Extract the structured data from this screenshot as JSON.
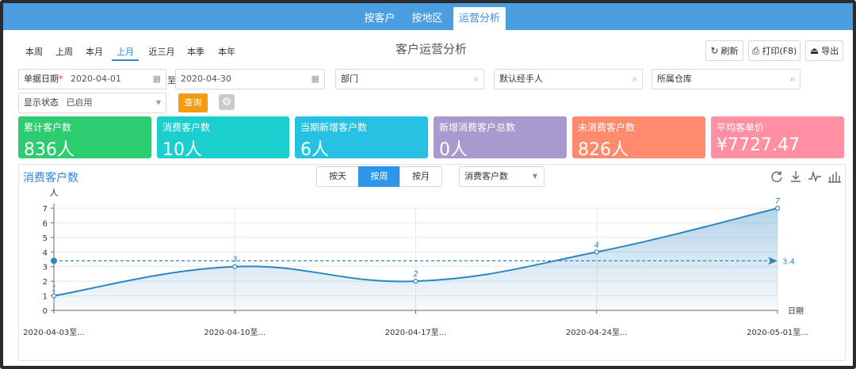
{
  "nav": {
    "tabs": [
      {
        "label": "按客户"
      },
      {
        "label": "按地区"
      },
      {
        "label": "运营分析"
      }
    ]
  },
  "periods": [
    "本周",
    "上周",
    "本月",
    "上月",
    "近三月",
    "本季",
    "本年"
  ],
  "page_title": "客户运营分析",
  "actions": {
    "refresh": "刷新",
    "print": "打印(F8)",
    "export": "导出"
  },
  "filters": {
    "date_label": "单据日期",
    "date_required_mark": "*",
    "date_from": "2020-04-01",
    "date_sep": "至",
    "date_to": "2020-04-30",
    "department_placeholder": "部门",
    "handler_value": "默认经手人",
    "warehouse_placeholder": "所属仓库",
    "status_label": "显示状态",
    "status_value": "已启用",
    "query_button": "查询"
  },
  "kpis": [
    {
      "title": "累计客户数",
      "value": "836人",
      "color": "#2ecc71"
    },
    {
      "title": "消费客户数",
      "value": "10人",
      "color": "#1ccfcf"
    },
    {
      "title": "当期新增客户数",
      "value": "6人",
      "color": "#27c2e3"
    },
    {
      "title": "新增消费客户总数",
      "value": "0人",
      "color": "#a899cf"
    },
    {
      "title": "未消费客户数",
      "value": "826人",
      "color": "#ff8a6d"
    },
    {
      "title": "平均客单价",
      "value": "¥7727.47",
      "color": "#ff8fa3"
    }
  ],
  "chart_panel": {
    "title": "消费客户数",
    "granularity": [
      {
        "label": "按天"
      },
      {
        "label": "按周"
      },
      {
        "label": "按月"
      }
    ],
    "metric_select": "消费客户数"
  },
  "chart_data": {
    "type": "area",
    "ylabel": "人",
    "xlabel": "日期",
    "ylim": [
      0,
      7
    ],
    "yticks": [
      0,
      1,
      2,
      3,
      4,
      5,
      6,
      7
    ],
    "categories": [
      "2020-04-03至...",
      "2020-04-10至...",
      "2020-04-17至...",
      "2020-04-24至...",
      "2020-05-01至..."
    ],
    "values": [
      1,
      3,
      2,
      4,
      7
    ],
    "average": 3.4,
    "average_label": "3.4",
    "line_color": "#2e86c1",
    "smooth": true,
    "grid": true
  }
}
